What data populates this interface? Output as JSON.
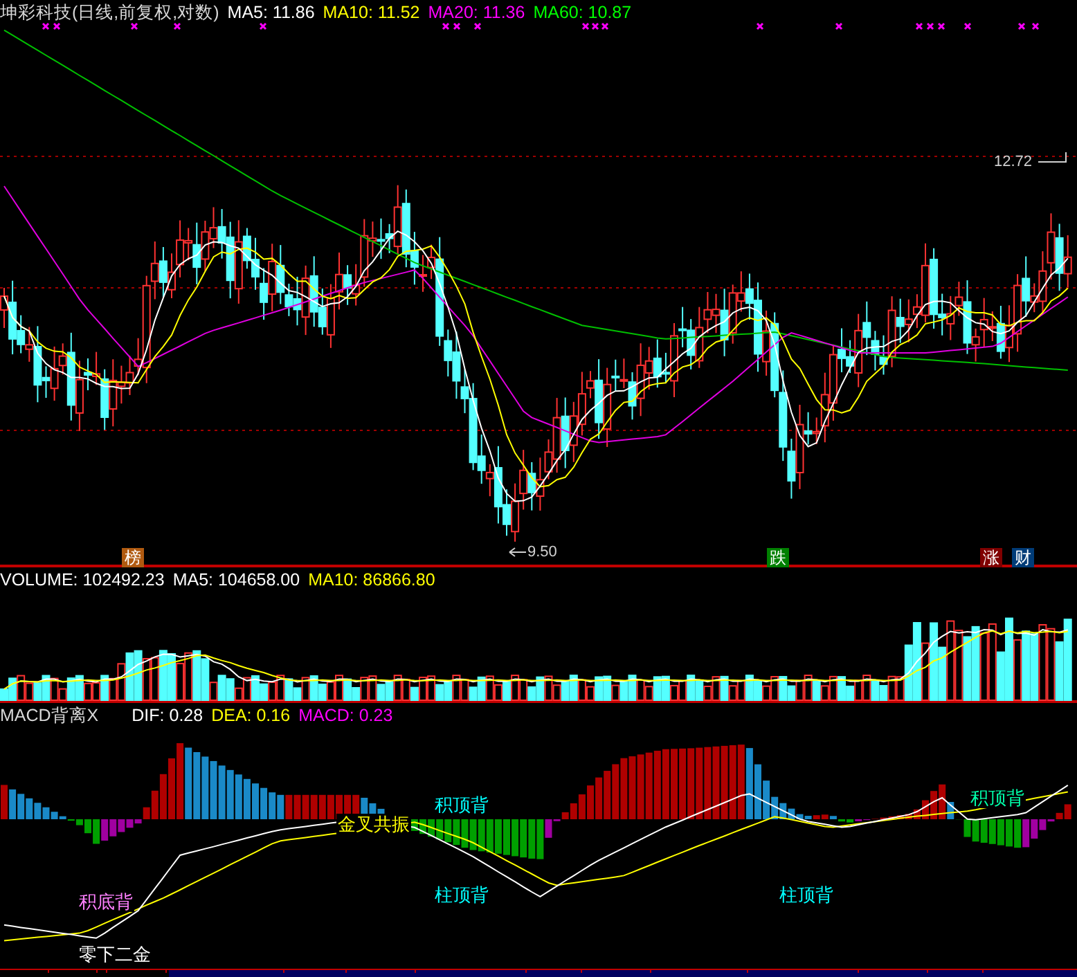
{
  "price_panel": {
    "title": "坤彩科技(日线,前复权,对数)",
    "indicators": [
      {
        "label": "MA5: 11.86",
        "color": "#ffffff"
      },
      {
        "label": "MA10: 11.52",
        "color": "#ffff00"
      },
      {
        "label": "MA20: 11.36",
        "color": "#ff00ff"
      },
      {
        "label": "MA60: 10.87",
        "color": "#00ff00"
      }
    ],
    "high_label": "12.72",
    "low_label": "9.50",
    "markers": [
      {
        "text": "榜",
        "color": "#b05a10"
      },
      {
        "text": "跌",
        "color": "#008000"
      },
      {
        "text": "涨",
        "color": "#800000"
      },
      {
        "text": "财",
        "color": "#003c78"
      }
    ]
  },
  "volume_panel": {
    "indicators": [
      {
        "label": "VOLUME: 102492.23",
        "color": "#ffffff"
      },
      {
        "label": "MA5: 104658.00",
        "color": "#ffffff"
      },
      {
        "label": "MA10: 86866.80",
        "color": "#ffff00"
      }
    ]
  },
  "macd_panel": {
    "title": "MACD背离X",
    "indicators": [
      {
        "label": "DIF: 0.28",
        "color": "#ffffff"
      },
      {
        "label": "DEA: 0.16",
        "color": "#ffff00"
      },
      {
        "label": "MACD: 0.23",
        "color": "#ff00ff"
      }
    ],
    "annotations": [
      {
        "text": "积底背",
        "color": "#ff80ff"
      },
      {
        "text": "金叉共振",
        "color": "#ffff00"
      },
      {
        "text": "积顶背",
        "color": "#00ffff"
      },
      {
        "text": "柱顶背",
        "color": "#00ffff"
      },
      {
        "text": "柱顶背",
        "color": "#00ffff"
      },
      {
        "text": "积顶背",
        "color": "#00ffaa"
      },
      {
        "text": "零下二金",
        "color": "#ffffff"
      }
    ]
  }
}
